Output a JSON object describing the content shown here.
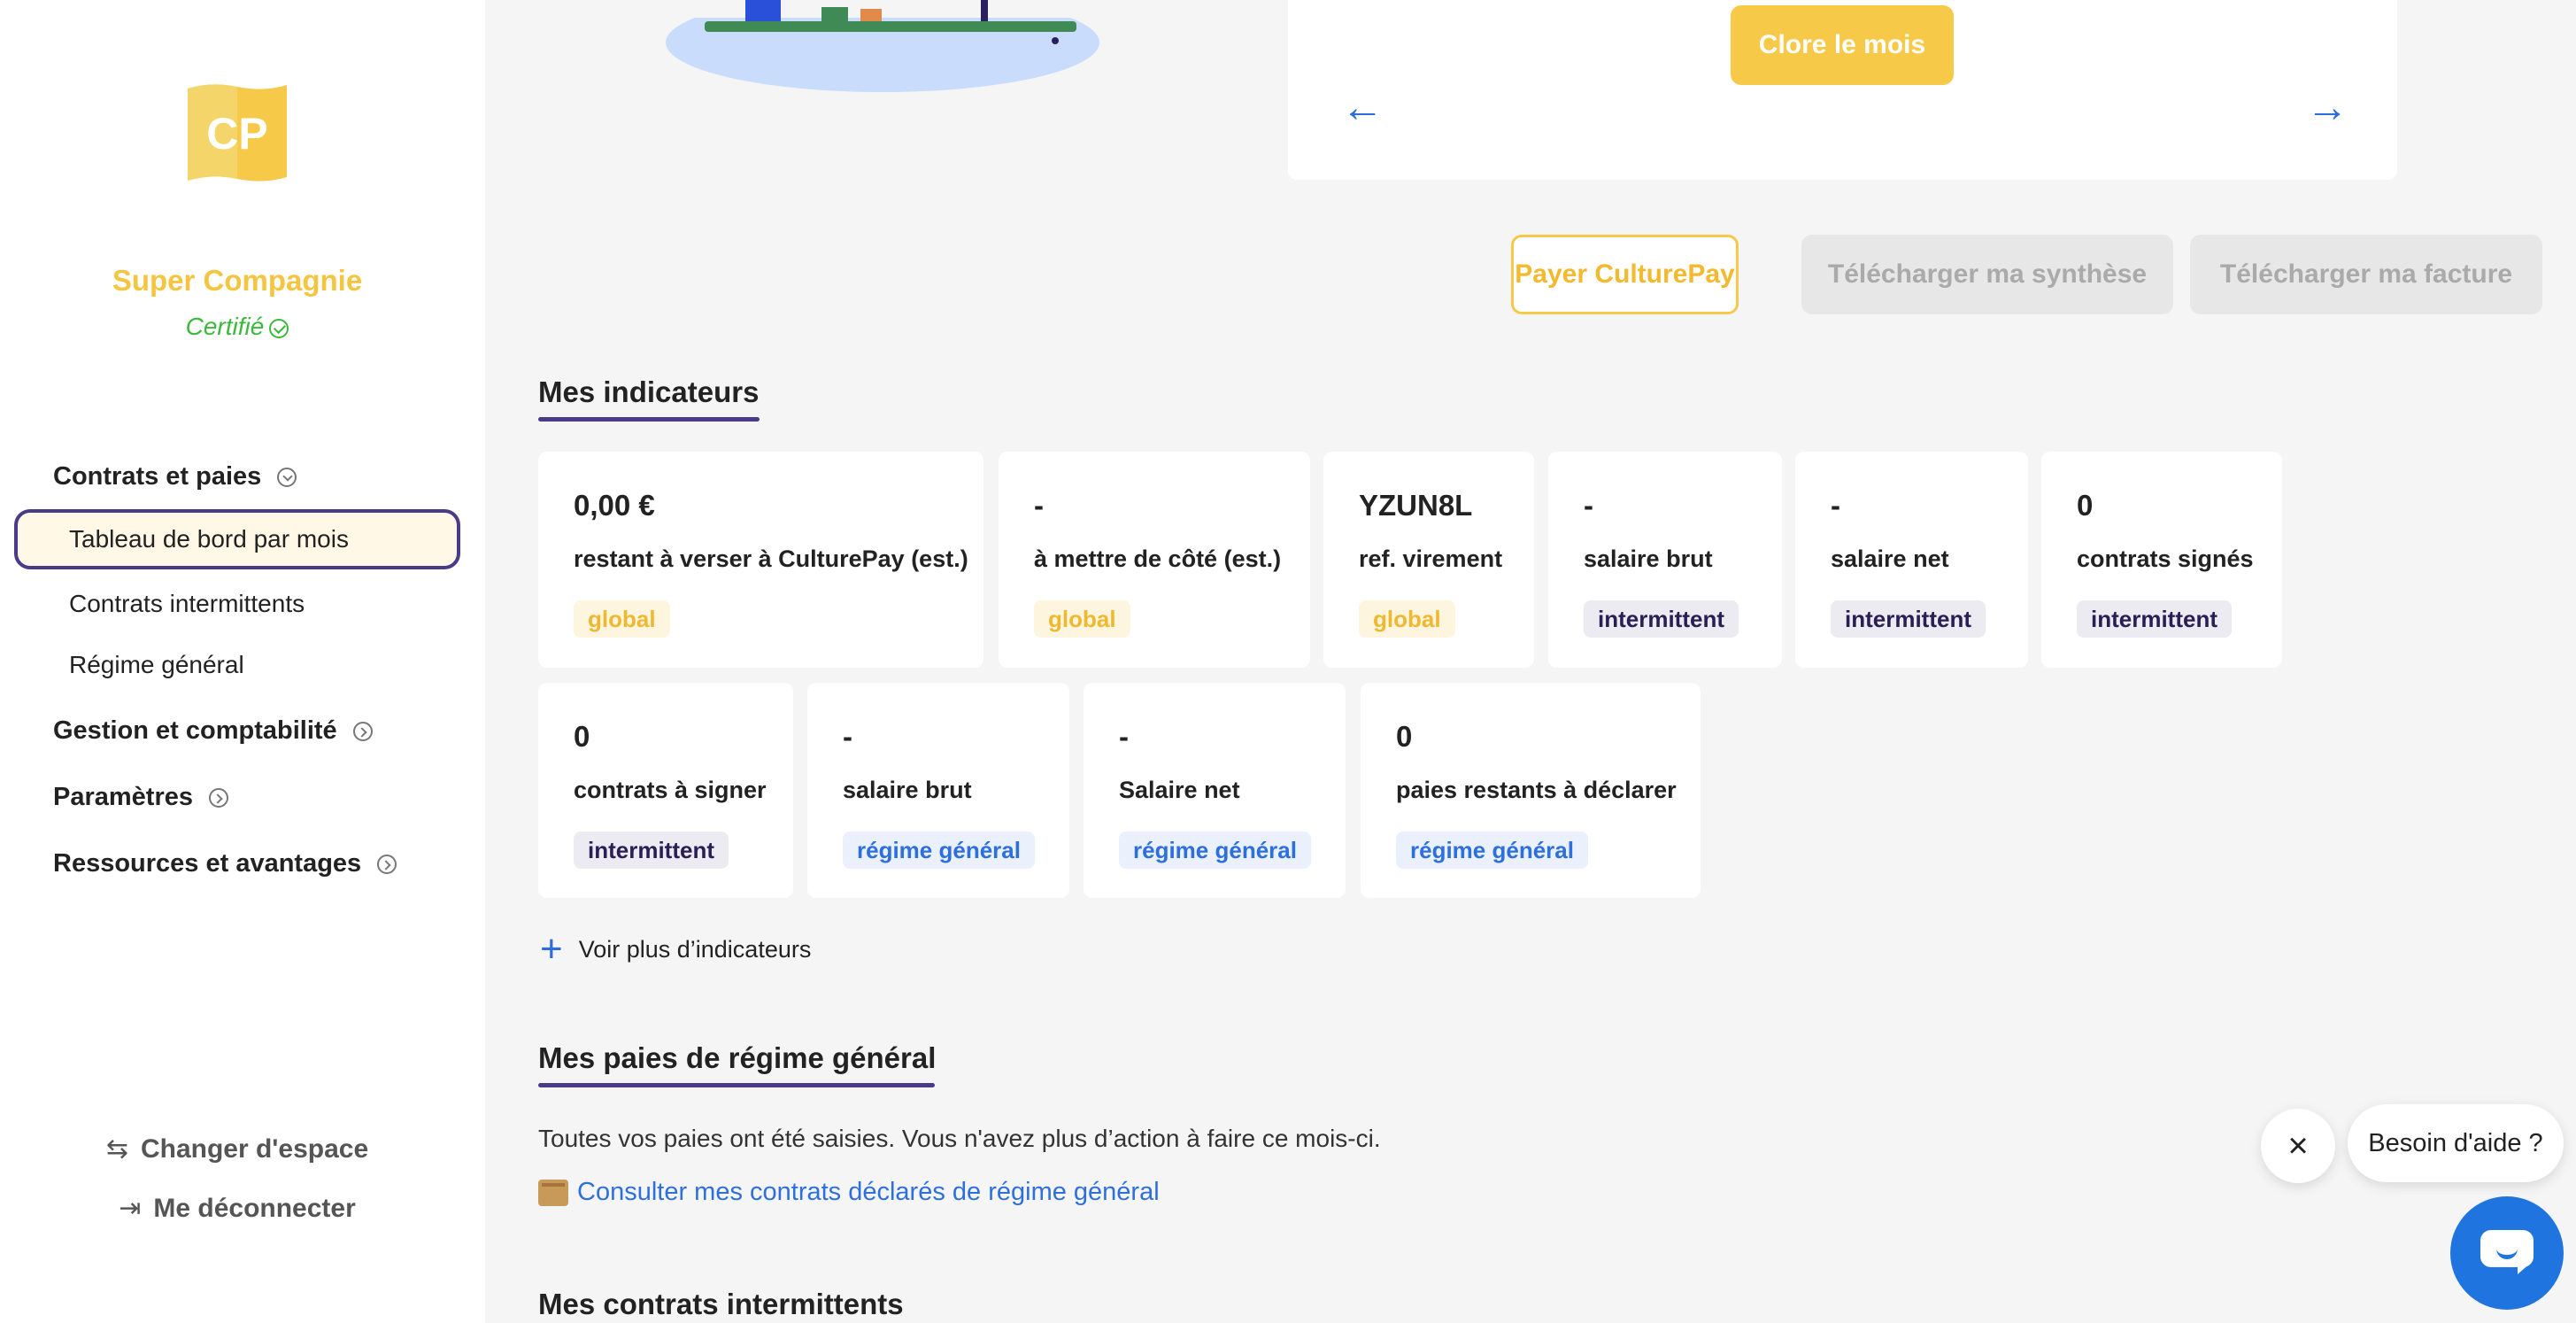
{
  "company": {
    "logo_text": "CP",
    "name": "Super Compagnie",
    "status": "Certifié"
  },
  "nav": {
    "sections": [
      {
        "label": "Contrats et paies"
      },
      {
        "label": "Gestion et comptabilité"
      },
      {
        "label": "Paramètres"
      },
      {
        "label": "Ressources et avantages"
      }
    ],
    "items": [
      {
        "label": "Tableau de bord par mois"
      },
      {
        "label": "Contrats intermittents"
      },
      {
        "label": "Régime général"
      }
    ]
  },
  "bottom_links": {
    "switch_space": "Changer d'espace",
    "logout": "Me déconnecter"
  },
  "month_card": {
    "close_month": "Clore le mois",
    "prev_icon": "arrow-left-icon",
    "next_icon": "arrow-right-icon"
  },
  "actions": {
    "pay": "Payer CulturePay",
    "download_summary": "Télécharger ma synthèse",
    "download_invoice": "Télécharger ma facture"
  },
  "indicators": {
    "title": "Mes indicateurs",
    "row1": [
      {
        "value": "0,00 €",
        "label": "restant à verser à CulturePay (est.)",
        "tag": "global"
      },
      {
        "value": "-",
        "label": "à mettre de côté (est.)",
        "tag": "global"
      },
      {
        "value": "YZUN8L",
        "label": "ref. virement",
        "tag": "global"
      },
      {
        "value": "-",
        "label": "salaire brut",
        "tag": "intermittent"
      },
      {
        "value": "-",
        "label": "salaire net",
        "tag": "intermittent"
      },
      {
        "value": "0",
        "label": "contrats signés",
        "tag": "intermittent"
      }
    ],
    "row2": [
      {
        "value": "0",
        "label": "contrats à signer",
        "tag": "intermittent"
      },
      {
        "value": "-",
        "label": "salaire brut",
        "tag": "régime général"
      },
      {
        "value": "-",
        "label": "Salaire net",
        "tag": "régime général"
      },
      {
        "value": "0",
        "label": "paies restants à déclarer",
        "tag": "régime général"
      }
    ],
    "more": "Voir plus d’indicateurs"
  },
  "general_pay": {
    "title": "Mes paies de régime général",
    "message": "Toutes vos paies ont été saisies. Vous n'avez plus d’action à faire ce mois-ci.",
    "link": "Consulter mes contrats déclarés de régime général"
  },
  "intermittent": {
    "title": "Mes contrats intermittents"
  },
  "help": {
    "label": "Besoin d'aide ?"
  },
  "colors": {
    "accent_yellow": "#f7c948",
    "purple": "#4a3a8a",
    "blue": "#2b6de0",
    "green": "#3cb93c"
  }
}
